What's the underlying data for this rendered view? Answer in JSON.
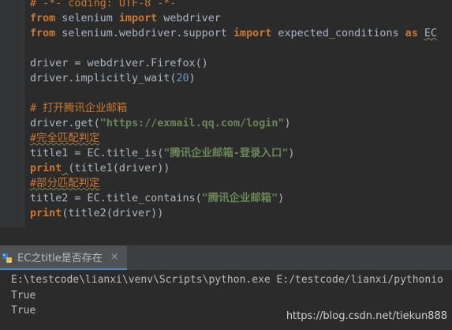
{
  "editor": {
    "lines": [
      [
        {
          "t": "# -*- coding: UTF-8 -*-",
          "c": "c-comment"
        }
      ],
      [
        {
          "t": "from",
          "c": "c-kw"
        },
        {
          "t": " selenium "
        },
        {
          "t": "import",
          "c": "c-kw"
        },
        {
          "t": " webdriver"
        }
      ],
      [
        {
          "t": "from",
          "c": "c-kw"
        },
        {
          "t": " selenium.webdriver.support "
        },
        {
          "t": "import",
          "c": "c-kw"
        },
        {
          "t": " expected_conditions "
        },
        {
          "t": "as",
          "c": "c-kw"
        },
        {
          "t": " "
        },
        {
          "t": "EC",
          "c": "wavy"
        }
      ],
      [
        {
          "t": ""
        }
      ],
      [
        {
          "t": "driver = webdriver.Firefox()"
        }
      ],
      [
        {
          "t": "driver.implicitly_wait("
        },
        {
          "t": "20",
          "c": "c-num"
        },
        {
          "t": ")"
        }
      ],
      [
        {
          "t": ""
        }
      ],
      [
        {
          "t": "# 打开腾讯企业邮箱",
          "c": "c-comment"
        }
      ],
      [
        {
          "t": "driver.get("
        },
        {
          "t": "\"https://exmail.qq.com/login\"",
          "c": "c-str"
        },
        {
          "t": ")"
        }
      ],
      [
        {
          "t": "#完全匹配判定",
          "c": "c-comment wavy"
        }
      ],
      [
        {
          "t": "title1 = EC.title_is("
        },
        {
          "t": "\"腾讯企业邮箱-登录入口\"",
          "c": "c-str"
        },
        {
          "t": ")"
        }
      ],
      [
        {
          "t": "print",
          "c": "c-kw"
        },
        {
          "t": " ",
          "c": "wavy"
        },
        {
          "t": "(title1(driver))"
        }
      ],
      [
        {
          "t": "#部分匹配判定",
          "c": "c-comment wavy"
        }
      ],
      [
        {
          "t": "title2 = EC.title_contains("
        },
        {
          "t": "\"腾讯企业邮箱\"",
          "c": "c-str"
        },
        {
          "t": ")"
        }
      ],
      [
        {
          "t": "print",
          "c": "c-kw"
        },
        {
          "t": "(title2(driver))"
        },
        {
          "t": "",
          "c": "wavy"
        }
      ]
    ]
  },
  "run_panel": {
    "tab_label": "EC之title是否存在",
    "close_symbol": "×",
    "tab_icon": "python-run-icon"
  },
  "console": {
    "lines": [
      "E:\\testcode\\lianxi\\venv\\Scripts\\python.exe E:/testcode/lianxi/pythonio",
      "True",
      "True"
    ]
  },
  "watermark": "https://blog.csdn.net/tiekun888",
  "colors": {
    "background": "#2b2b2b",
    "keyword": "#cc7832",
    "string": "#6a8759",
    "number": "#6897bb",
    "text": "#a9b7c6",
    "tab_accent": "#4a88c7"
  }
}
